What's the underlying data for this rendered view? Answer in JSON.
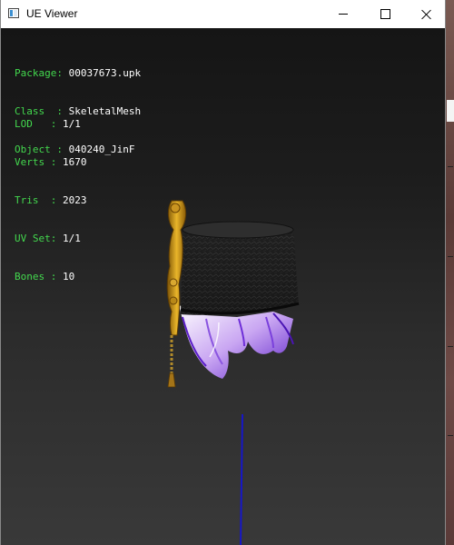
{
  "window": {
    "title": "UE Viewer"
  },
  "info_block_1": [
    {
      "key": "Package",
      "value": "00037673.upk"
    },
    {
      "key": "Class  ",
      "value": "SkeletalMesh"
    },
    {
      "key": "Object ",
      "value": "040240_JinF"
    }
  ],
  "info_block_2": [
    {
      "key": "LOD   ",
      "value": "1/1"
    },
    {
      "key": "Verts ",
      "value": "1670"
    },
    {
      "key": "Tris  ",
      "value": "2023"
    },
    {
      "key": "UV Set",
      "value": "1/1"
    },
    {
      "key": "Bones ",
      "value": "10"
    }
  ],
  "colors": {
    "label": "#43d84e",
    "value": "#ffffff",
    "bone_axis": "#1616c8"
  }
}
